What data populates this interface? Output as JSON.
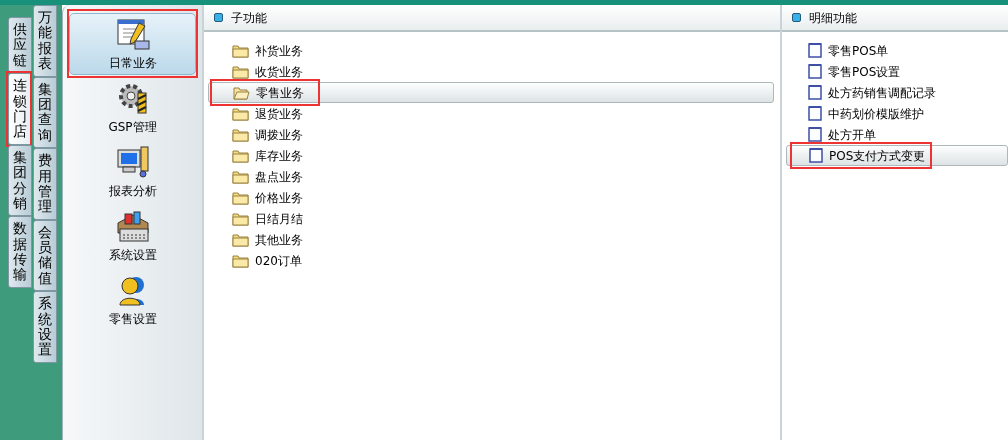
{
  "outer_tabs": [
    {
      "label": "供应链",
      "selected": false,
      "highlighted": false
    },
    {
      "label": "连锁门店",
      "selected": true,
      "highlighted": true
    },
    {
      "label": "集团分销",
      "selected": false,
      "highlighted": false
    },
    {
      "label": "数据传输",
      "selected": false,
      "highlighted": false
    }
  ],
  "inner_tabs": [
    {
      "label": "万能报表",
      "selected": false
    },
    {
      "label": "集团查询",
      "selected": false
    },
    {
      "label": "费用管理",
      "selected": false
    },
    {
      "label": "会员储值",
      "selected": false
    },
    {
      "label": "系统设置",
      "selected": false
    }
  ],
  "modules": [
    {
      "label": "日常业务",
      "selected": true,
      "highlighted": true
    },
    {
      "label": "GSP管理",
      "selected": false,
      "highlighted": false
    },
    {
      "label": "报表分析",
      "selected": false,
      "highlighted": false
    },
    {
      "label": "系统设置",
      "selected": false,
      "highlighted": false
    },
    {
      "label": "零售设置",
      "selected": false,
      "highlighted": false
    }
  ],
  "sub_panel": {
    "title": "子功能",
    "items": [
      {
        "label": "补货业务",
        "selected": false,
        "highlighted": false
      },
      {
        "label": "收货业务",
        "selected": false,
        "highlighted": false
      },
      {
        "label": "零售业务",
        "selected": true,
        "highlighted": true
      },
      {
        "label": "退货业务",
        "selected": false,
        "highlighted": false
      },
      {
        "label": "调拨业务",
        "selected": false,
        "highlighted": false
      },
      {
        "label": "库存业务",
        "selected": false,
        "highlighted": false
      },
      {
        "label": "盘点业务",
        "selected": false,
        "highlighted": false
      },
      {
        "label": "价格业务",
        "selected": false,
        "highlighted": false
      },
      {
        "label": "日结月结",
        "selected": false,
        "highlighted": false
      },
      {
        "label": "其他业务",
        "selected": false,
        "highlighted": false
      },
      {
        "label": "020订单",
        "selected": false,
        "highlighted": false
      }
    ]
  },
  "detail_panel": {
    "title": "明细功能",
    "items": [
      {
        "label": "零售POS单",
        "selected": false,
        "highlighted": false
      },
      {
        "label": "零售POS设置",
        "selected": false,
        "highlighted": false
      },
      {
        "label": "处方药销售调配记录",
        "selected": false,
        "highlighted": false
      },
      {
        "label": "中药划价模版维护",
        "selected": false,
        "highlighted": false
      },
      {
        "label": "处方开单",
        "selected": false,
        "highlighted": false
      },
      {
        "label": "POS支付方式变更",
        "selected": true,
        "highlighted": true
      }
    ]
  }
}
